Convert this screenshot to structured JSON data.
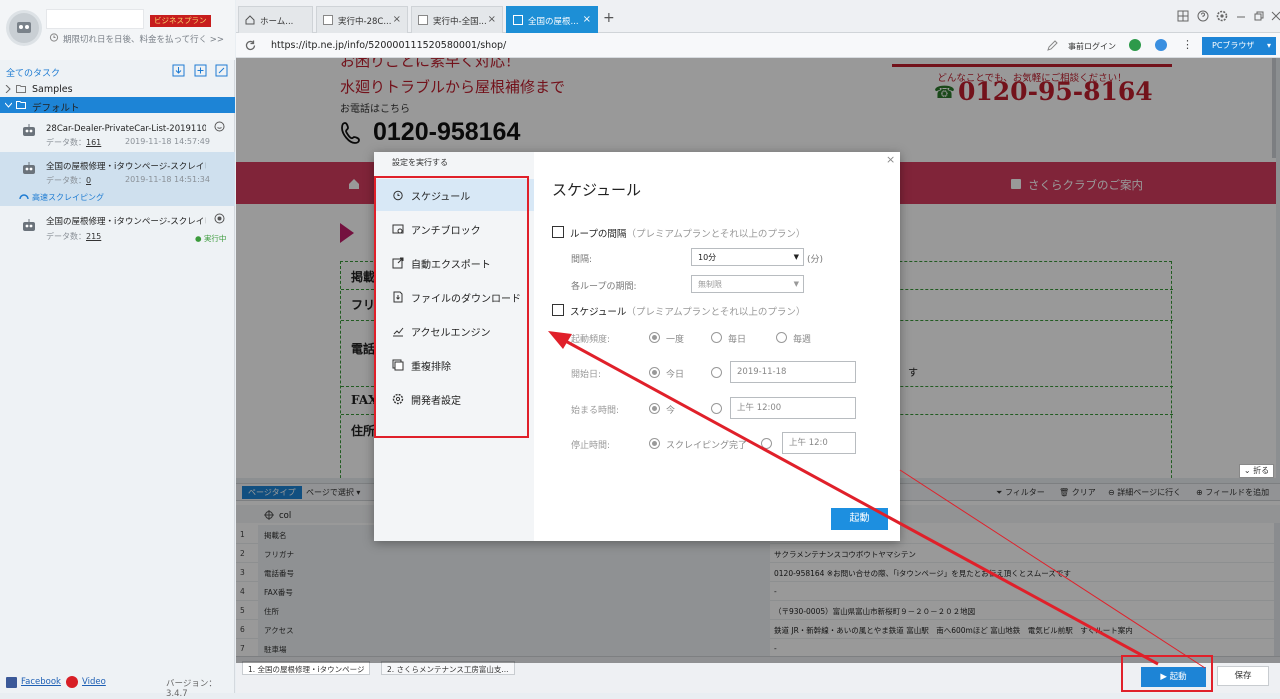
{
  "sidebar": {
    "plan_badge": "ビジネスプラン",
    "expiry_text": "期限切れ日を日後、料金を払って行く >>",
    "all_tasks": "全てのタスク",
    "folders": [
      {
        "label": "Samples"
      },
      {
        "label": "デフォルト"
      }
    ],
    "tasks": [
      {
        "name": "28Car-Dealer-PrivateCar-List-20191106的...",
        "count_label": "データ数：",
        "count": "161",
        "time": "2019-11-18 14:57:49"
      },
      {
        "name": "全国の屋根修理・iタウンページ-スクレイピ...",
        "count_label": "データ数：",
        "count": "0",
        "time": "2019-11-18 14:51:34",
        "accel": "高速スクレイピング"
      },
      {
        "name": "全国の屋根修理・iタウンページ-スクレイピ...",
        "count_label": "データ数：",
        "count": "215",
        "status": "実行中"
      }
    ],
    "footer": {
      "facebook": "Facebook",
      "video": "Video",
      "version": "バージョン：3.4.7"
    }
  },
  "tabs": [
    {
      "label": "ホーム..."
    },
    {
      "label": "実行中-28C..."
    },
    {
      "label": "実行中-全国..."
    },
    {
      "label": "全国の屋根..."
    }
  ],
  "address": {
    "url": "https://itp.ne.jp/info/520000111520580001/shop/",
    "login": "事前ログイン",
    "mode": "PCブラウザ"
  },
  "web": {
    "red1": "お困りごとに素早く対応！",
    "red2": "水廻りトラブルから屋根補修まで",
    "call_label": "お電話はこちら",
    "phone": "0120-958164",
    "consult": "どんなことでも、お気軽にご相談ください！",
    "free_dial": "0120-95-8164",
    "sakura": "さくらクラブのご案内",
    "cells": [
      "掲載",
      "フリ",
      "電話",
      "FAX",
      "住所"
    ],
    "su": "す",
    "fold": "折る"
  },
  "datapane": {
    "page_type": "ページタイプ",
    "page_select": "ページで選択 ▾",
    "filter": "フィルター",
    "clear": "クリア",
    "detail": "詳細ページに行く",
    "add_field": "フィールドを追加",
    "col": "col",
    "rows": [
      {
        "n": "1",
        "k": "掲載名",
        "v": ""
      },
      {
        "n": "2",
        "k": "フリガナ",
        "v": "サクラメンテナンスコウボウトヤマシテン"
      },
      {
        "n": "3",
        "k": "電話番号",
        "v": "0120-958164 ※お問い合せの際、「iタウンページ」を見たとお伝え頂くとスムーズです"
      },
      {
        "n": "4",
        "k": "FAX番号",
        "v": "-"
      },
      {
        "n": "5",
        "k": "住所",
        "v": "（〒930-0005）富山県富山市新桜町９－２０－２０２地図"
      },
      {
        "n": "6",
        "k": "アクセス",
        "v": "鉄道 JR・新幹線・あいの風とやま鉄道 富山駅　南へ600mほど 富山地鉄　電気ビル前駅　すぐルート案内"
      },
      {
        "n": "7",
        "k": "駐車場",
        "v": "-"
      }
    ],
    "bottom_tabs": [
      "1. 全国の屋根修理・iタウンページ",
      "2. さくらメンテナンス工房富山支..."
    ],
    "start": "起動",
    "save": "保存"
  },
  "modal": {
    "side_title": "設定を実行する",
    "menu": [
      {
        "label": "スケジュール",
        "icon": "alarm-clock-icon"
      },
      {
        "label": "アンチブロック",
        "icon": "shield-block-icon"
      },
      {
        "label": "自動エクスポート",
        "icon": "export-icon"
      },
      {
        "label": "ファイルのダウンロード",
        "icon": "file-download-icon"
      },
      {
        "label": "アクセルエンジン",
        "icon": "accelerate-icon"
      },
      {
        "label": "重複排除",
        "icon": "dedupe-icon"
      },
      {
        "label": "開発者設定",
        "icon": "gear-icon"
      }
    ],
    "title": "スケジュール",
    "loop": {
      "label": "ループの間隔",
      "note": "（プレミアムプランとそれ以上のプラン）",
      "interval_label": "間隔:",
      "interval_value": "10分",
      "unit": "(分)",
      "period_label": "各ループの期間:",
      "period_value": "無制限"
    },
    "schedule": {
      "label": "スケジュール",
      "note": "（プレミアムプランとそれ以上のプラン）",
      "freq_label": "起動頻度:",
      "freq_opts": [
        "一度",
        "毎日",
        "毎週"
      ],
      "start_date_label": "開始日:",
      "today": "今日",
      "date_value": "2019-11-18",
      "start_time_label": "始まる時間:",
      "now": "今",
      "time_value": "上午 12:00",
      "stop_time_label": "停止時間:",
      "done": "スクレイピング完了",
      "stop_value": "上午 12:0"
    },
    "run": "起動"
  },
  "colors": {
    "accent": "#1d84d6",
    "nav_pink": "#d63c5f",
    "annotation_red": "#e0202a"
  }
}
